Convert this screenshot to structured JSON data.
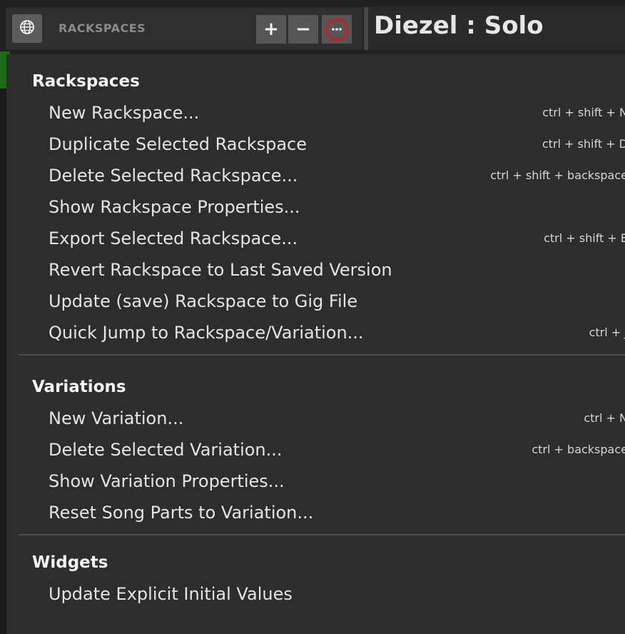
{
  "header": {
    "section_caption": "RACKSPACES",
    "add_label": "+",
    "remove_label": "−",
    "more_label": "···",
    "rackspace_title": "Diezel : Solo",
    "highlight_color": "#c81f1f",
    "accent_green": "#1d6b14"
  },
  "menu": {
    "sections": [
      {
        "heading": "Rackspaces",
        "items": [
          {
            "label": "New Rackspace...",
            "shortcut": "ctrl + shift + N"
          },
          {
            "label": "Duplicate Selected Rackspace",
            "shortcut": "ctrl + shift + D"
          },
          {
            "label": "Delete Selected Rackspace...",
            "shortcut": "ctrl + shift + backspace"
          },
          {
            "label": "Show Rackspace Properties...",
            "shortcut": ""
          },
          {
            "label": "Export Selected Rackspace...",
            "shortcut": "ctrl + shift + E"
          },
          {
            "label": "Revert Rackspace to Last Saved Version",
            "shortcut": ""
          },
          {
            "label": "Update (save) Rackspace to Gig File",
            "shortcut": ""
          },
          {
            "label": "Quick Jump to Rackspace/Variation...",
            "shortcut": "ctrl + J"
          }
        ]
      },
      {
        "heading": "Variations",
        "items": [
          {
            "label": "New Variation...",
            "shortcut": "ctrl + N"
          },
          {
            "label": "Delete Selected Variation...",
            "shortcut": "ctrl + backspace"
          },
          {
            "label": "Show Variation Properties...",
            "shortcut": ""
          },
          {
            "label": "Reset Song Parts to Variation...",
            "shortcut": ""
          }
        ]
      },
      {
        "heading": "Widgets",
        "items": [
          {
            "label": "Update Explicit Initial Values",
            "shortcut": ""
          }
        ]
      }
    ]
  },
  "icons": {
    "globe": "globe-icon",
    "more": "more-icon"
  }
}
